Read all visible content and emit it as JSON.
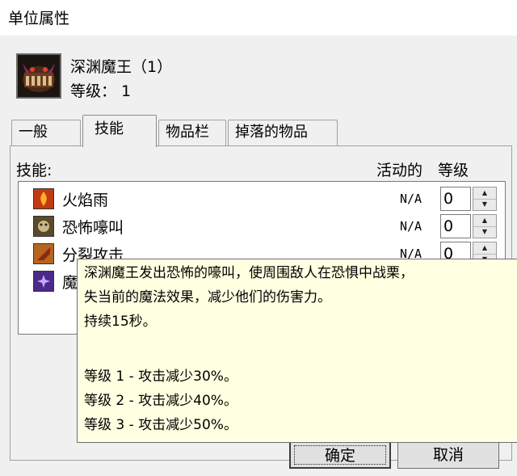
{
  "window": {
    "title": "单位属性"
  },
  "unit": {
    "name": "深渊魔王（1）",
    "level_text": "等级： 1"
  },
  "tabs": [
    {
      "label": "一般"
    },
    {
      "label": "技能"
    },
    {
      "label": "物品栏"
    },
    {
      "label": "掉落的物品"
    }
  ],
  "skills": {
    "header": "技能:",
    "col_active": "活动的",
    "col_level": "等级",
    "rows": [
      {
        "name": "火焰雨",
        "active": "N/A",
        "level": "0",
        "icon": "fire-rain-icon",
        "color": "#c23a0f"
      },
      {
        "name": "恐怖嚎叫",
        "active": "N/A",
        "level": "0",
        "icon": "howl-icon",
        "color": "#5a4a2a"
      },
      {
        "name": "分裂攻击",
        "active": "N/A",
        "level": "0",
        "icon": "cleave-icon",
        "color": "#b5651d"
      },
      {
        "name": "魔",
        "active": "",
        "level": "",
        "icon": "magic-icon",
        "color": "#4b2a8a"
      }
    ]
  },
  "tooltip": {
    "lines": [
      "深渊魔王发出恐怖的嚎叫，使周围敌人在恐惧中战栗，",
      "失当前的魔法效果，减少他们的伤害力。",
      "持续15秒。",
      "",
      "等级 1 - 攻击减少30%。",
      "等级 2 - 攻击减少40%。",
      "等级 3 - 攻击减少50%。"
    ]
  },
  "buttons": {
    "ok": "确定",
    "cancel": "取消"
  }
}
